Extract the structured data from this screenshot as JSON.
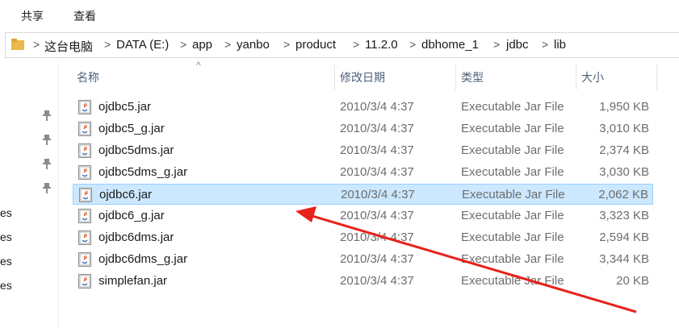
{
  "ribbon": {
    "tabs": [
      "共享",
      "查看"
    ]
  },
  "address_bar": {
    "crumbs": [
      "这台电脑",
      "DATA (E:)",
      "app",
      "yanbo",
      "product",
      "11.2.0",
      "dbhome_1",
      "jdbc",
      "lib"
    ],
    "separator": ">"
  },
  "nav_pane": {
    "fragments": [
      "es",
      "es",
      "es",
      "es"
    ]
  },
  "columns": {
    "name": "名称",
    "modified": "修改日期",
    "type": "类型",
    "size": "大小"
  },
  "files": [
    {
      "name": "ojdbc5.jar",
      "modified": "2010/3/4 4:37",
      "type": "Executable Jar File",
      "size": "1,950 KB"
    },
    {
      "name": "ojdbc5_g.jar",
      "modified": "2010/3/4 4:37",
      "type": "Executable Jar File",
      "size": "3,010 KB"
    },
    {
      "name": "ojdbc5dms.jar",
      "modified": "2010/3/4 4:37",
      "type": "Executable Jar File",
      "size": "2,374 KB"
    },
    {
      "name": "ojdbc5dms_g.jar",
      "modified": "2010/3/4 4:37",
      "type": "Executable Jar File",
      "size": "3,030 KB"
    },
    {
      "name": "ojdbc6.jar",
      "modified": "2010/3/4 4:37",
      "type": "Executable Jar File",
      "size": "2,062 KB",
      "selected": true
    },
    {
      "name": "ojdbc6_g.jar",
      "modified": "2010/3/4 4:37",
      "type": "Executable Jar File",
      "size": "3,323 KB"
    },
    {
      "name": "ojdbc6dms.jar",
      "modified": "2010/3/4 4:37",
      "type": "Executable Jar File",
      "size": "2,594 KB"
    },
    {
      "name": "ojdbc6dms_g.jar",
      "modified": "2010/3/4 4:37",
      "type": "Executable Jar File",
      "size": "3,344 KB"
    },
    {
      "name": "simplefan.jar",
      "modified": "2010/3/4 4:37",
      "type": "Executable Jar File",
      "size": "20 KB"
    }
  ],
  "colors": {
    "selection_bg": "#cce8ff",
    "selection_border": "#99d1ff",
    "annotation_arrow": "#e8211b"
  },
  "icons": {
    "file": "java-jar-icon",
    "folder": "folder-icon",
    "pin": "pin-icon",
    "sort": "sort-up-icon"
  }
}
